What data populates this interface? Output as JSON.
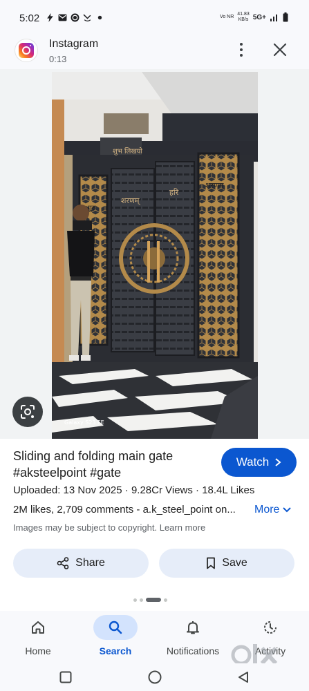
{
  "status_bar": {
    "time": "5:02",
    "network_speed_value": "41.83",
    "network_speed_unit": "KB/s",
    "network_type": "5G+",
    "volte": "Vo NR"
  },
  "app": {
    "name": "Instagram",
    "subtitle": "0:13"
  },
  "image": {
    "camera_watermark": "Galaxy S23 FE",
    "gate_texts": [
      "शुभ लिखयो",
      "गुरु",
      "शरणम्",
      "हरि",
      "शरणम्"
    ]
  },
  "result": {
    "title": "Sliding and folding main gate #aksteelpoint #gate",
    "watch_label": "Watch",
    "meta": "Uploaded: 13 Nov 2025  ·  9.28Cr Views  ·  18.4L Likes",
    "description": "2M likes, 2,709 comments - a.k_steel_point on...",
    "more_label": "More",
    "copyright_note": "Images may be subject to copyright. Learn more",
    "share_label": "Share",
    "save_label": "Save"
  },
  "bottom_nav": {
    "items": [
      {
        "label": "Home",
        "icon": "home-icon"
      },
      {
        "label": "Search",
        "icon": "search-icon",
        "active": true
      },
      {
        "label": "Notifications",
        "icon": "bell-icon"
      },
      {
        "label": "Activity",
        "icon": "activity-icon"
      }
    ]
  },
  "watermark": {
    "text": "olx"
  },
  "colors": {
    "accent": "#0b57d0",
    "button_bg": "#e6edf9",
    "nav_active_pill": "#d3e3fd"
  }
}
